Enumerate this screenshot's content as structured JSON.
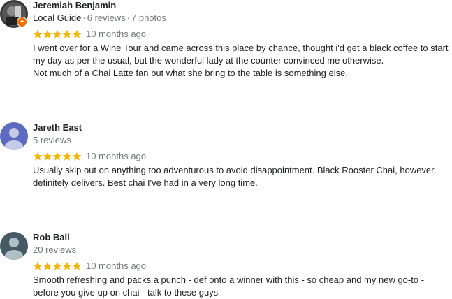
{
  "colors": {
    "star": "#f4b400",
    "badge": "#e8710a",
    "avatar_purple": "#5c6bc0",
    "avatar_gray": "#455a64"
  },
  "reviews": [
    {
      "name": "Jeremiah Benjamin",
      "guide": "Local Guide",
      "reviews": "6 reviews",
      "photos": "7 photos",
      "rating": 5,
      "date": "10 months ago",
      "text1": "I went over for a Wine Tour and came across this place by chance, thought i'd get a black coffee to start my day as per the usual, but the wonderful lady at the counter convinced me otherwise.",
      "text2": "Not much of a Chai Latte fan but what she bring to the table is something else."
    },
    {
      "name": "Jareth East",
      "reviews": "5 reviews",
      "rating": 5,
      "date": "10 months ago",
      "text1": "Usually skip out on anything too adventurous to avoid disappointment. Black Rooster Chai, however, definitely delivers. Best chai I've had in a very long time."
    },
    {
      "name": "Rob Ball",
      "reviews": "20 reviews",
      "rating": 5,
      "date": "10 months ago",
      "text1": "Smooth refreshing and packs a punch - def onto a winner with this - so cheap and my new go-to - before you give up on chai - talk to these guys"
    }
  ]
}
